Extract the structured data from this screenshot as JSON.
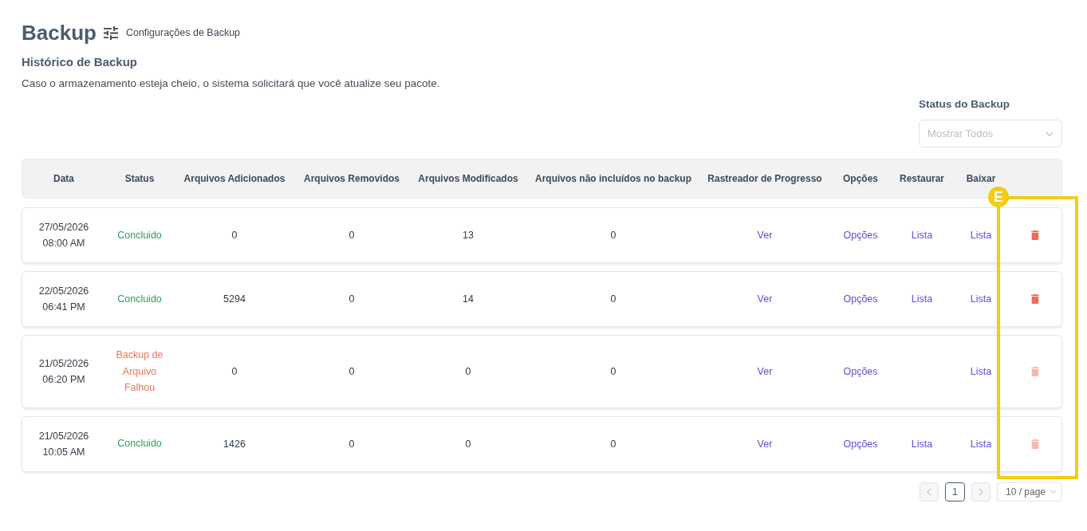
{
  "header": {
    "title": "Backup",
    "settings_link": "Configurações de Backup"
  },
  "section": {
    "title": "Histórico de Backup",
    "description": "Caso o armazenamento esteja cheio, o sistema solicitará que você atualize seu pacote."
  },
  "filter": {
    "label": "Status do Backup",
    "placeholder": "Mostrar Todos"
  },
  "table": {
    "columns": [
      "Data",
      "Status",
      "Arquivos Adicionados",
      "Arquivos Removidos",
      "Arquivos Modificados",
      "Arquivos não incluídos no backup",
      "Rastreador de Progresso",
      "Opções",
      "Restaurar",
      "Baixar"
    ],
    "rows": [
      {
        "kind": "success",
        "datetime": "27/05/2026 08:00 AM",
        "status": "Concluido",
        "added": "0",
        "removed": "0",
        "modified": "13",
        "excluded": "0",
        "progress": "Ver",
        "options": "Opções",
        "restore": "Lista",
        "download": "Lista",
        "delete_disabled": false
      },
      {
        "kind": "success",
        "datetime": "22/05/2026 06:41 PM",
        "status": "Concluido",
        "added": "5294",
        "removed": "0",
        "modified": "14",
        "excluded": "0",
        "progress": "Ver",
        "options": "Opções",
        "restore": "Lista",
        "download": "Lista",
        "delete_disabled": false
      },
      {
        "kind": "failed",
        "datetime": "21/05/2026 06:20 PM",
        "status": "Backup de Arquivo Falhou",
        "added": "0",
        "removed": "0",
        "modified": "0",
        "excluded": "0",
        "progress": "Ver",
        "options": "Opções",
        "download": "Lista",
        "delete_disabled": true
      },
      {
        "kind": "success",
        "datetime": "21/05/2026 10:05 AM",
        "status": "Concluido",
        "added": "1426",
        "removed": "0",
        "modified": "0",
        "excluded": "0",
        "progress": "Ver",
        "options": "Opções",
        "restore": "Lista",
        "download": "Lista",
        "delete_disabled": true
      }
    ]
  },
  "pagination": {
    "prev_disabled": true,
    "pages": [
      {
        "label": "1",
        "selected": true
      }
    ],
    "next_disabled": true,
    "page_size": "10 / page"
  },
  "annotation": {
    "label": "E"
  }
}
